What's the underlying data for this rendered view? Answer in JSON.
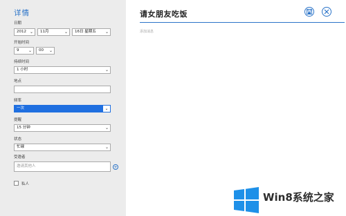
{
  "left": {
    "heading": "详情",
    "date_label": "日期",
    "year": "2012",
    "month": "11月",
    "day": "16日 星期五",
    "start_label": "开始时间",
    "hour": "9",
    "minute": "00",
    "duration_label": "持续时间",
    "duration": "1 小时",
    "location_label": "地点",
    "location_value": "",
    "frequency_label": "频率",
    "frequency": "一次",
    "reminder_label": "提醒",
    "reminder": "15 分钟",
    "status_label": "状态",
    "status": "忙碌",
    "invitees_label": "受邀者",
    "invitees_placeholder": "邀请其他人",
    "private_label": "私人"
  },
  "right": {
    "event_title": "请女朋友吃饭",
    "message_placeholder": "添加消息"
  },
  "icons": {
    "save": "save-icon",
    "close": "close-icon",
    "add": "plus-icon",
    "dropdown": "chevron-down-icon"
  },
  "watermark": {
    "text": "Win8系统之家"
  },
  "colors": {
    "accent": "#2a73c8",
    "highlight": "#1f6fe0",
    "panel_bg": "#ececec"
  }
}
